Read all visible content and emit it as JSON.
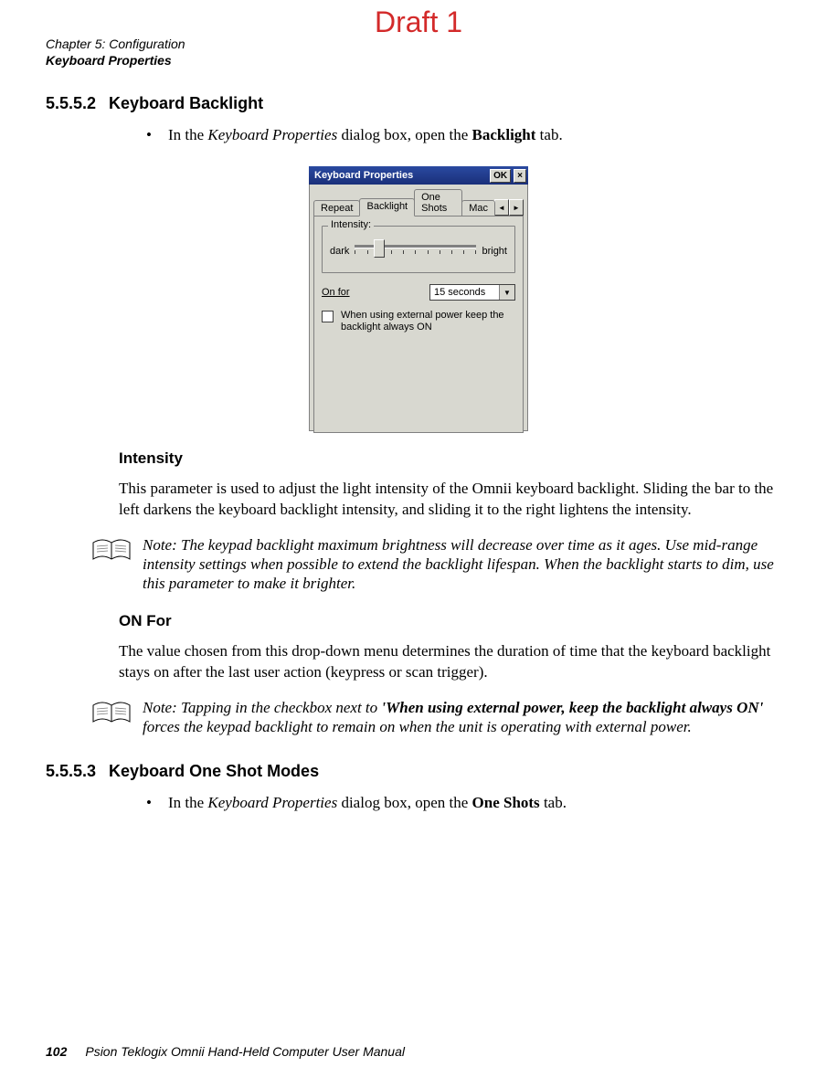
{
  "watermark": "Draft 1",
  "header": {
    "chapter": "Chapter 5: Configuration",
    "section": "Keyboard Properties"
  },
  "s1": {
    "num": "5.5.5.2",
    "title": "Keyboard Backlight",
    "bullet_prefix": "In the ",
    "bullet_em": "Keyboard Properties",
    "bullet_mid": " dialog box, open the ",
    "bullet_bold": "Backlight",
    "bullet_suffix": " tab."
  },
  "dialog": {
    "title": "Keyboard Properties",
    "ok": "OK",
    "close": "×",
    "tabs": {
      "repeat": "Repeat",
      "backlight": "Backlight",
      "oneshots": "One Shots",
      "mac": "Mac",
      "arrow_l": "◄",
      "arrow_r": "►"
    },
    "intensity_legend": "Intensity:",
    "dark": "dark",
    "bright": "bright",
    "onfor_label": "On for",
    "onfor_value": "15 seconds",
    "checkbox_label": "When using external power keep the backlight always ON"
  },
  "intensity": {
    "heading": "Intensity",
    "body": "This parameter is used to adjust the light intensity of the Omnii keyboard backlight. Sliding the bar to the left darkens the keyboard backlight intensity, and sliding it to the right lightens the intensity."
  },
  "note1": {
    "prefix": "Note: ",
    "text": "The keypad backlight maximum brightness will decrease over time as it ages. Use mid-range intensity settings when possible to extend the backlight lifespan. When the backlight starts to dim, use this parameter to make it brighter."
  },
  "onfor": {
    "heading": "ON For",
    "body": "The value chosen from this drop-down menu determines the duration of time that the keyboard backlight stays on after the last user action (keypress or scan trigger)."
  },
  "note2": {
    "prefix": "Note: ",
    "pre": "Tapping in the checkbox next to ",
    "bold": "'When using external power, keep the backlight always ON'",
    "post": " forces the keypad backlight to remain on when the unit is operating with external power."
  },
  "s2": {
    "num": "5.5.5.3",
    "title": "Keyboard One Shot Modes",
    "bullet_prefix": "In the ",
    "bullet_em": "Keyboard Properties",
    "bullet_mid": " dialog box, open the ",
    "bullet_bold": "One Shots",
    "bullet_suffix": " tab."
  },
  "footer": {
    "page": "102",
    "text": "Psion Teklogix Omnii Hand-Held Computer User Manual"
  }
}
